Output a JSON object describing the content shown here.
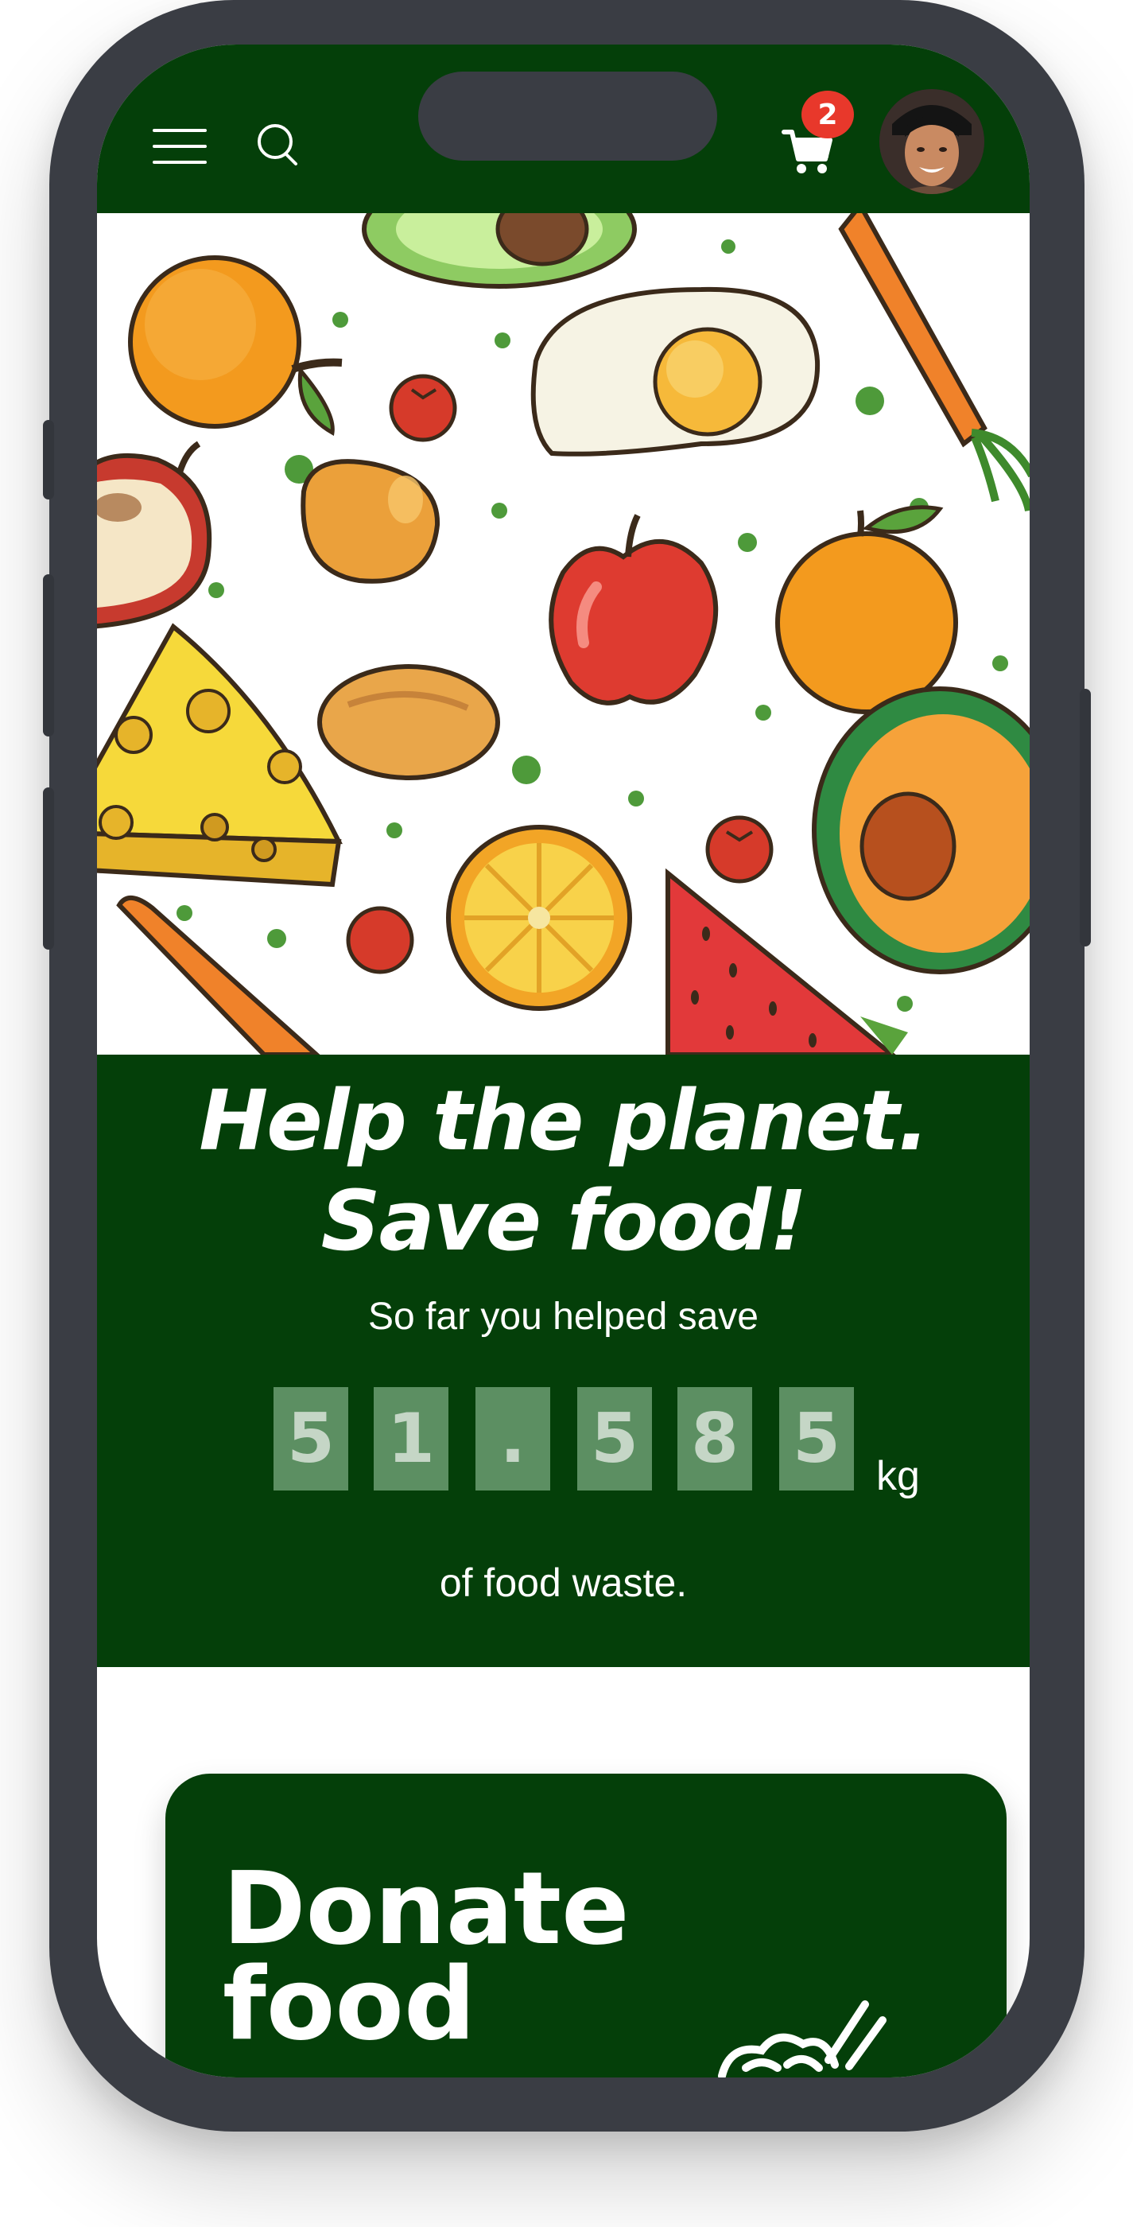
{
  "header": {
    "cart_count": "2"
  },
  "hero": {
    "illustration": "fruits-vegetables-illustration"
  },
  "stats": {
    "headline_line1": "Help the planet.",
    "headline_line2": "Save food!",
    "intro": "So far you helped save",
    "digits": [
      "5",
      "1",
      ".",
      "5",
      "8",
      "5"
    ],
    "unit": "kg",
    "outro": "of food waste."
  },
  "donate_card": {
    "title_line1": "Donate",
    "title_line2": "food",
    "icon": "food-bowl-icon"
  },
  "colors": {
    "brand_green": "#043f09",
    "digit_bg": "#5c8f62",
    "badge_red": "#e8382b",
    "phone_frame": "#3a3d44"
  }
}
